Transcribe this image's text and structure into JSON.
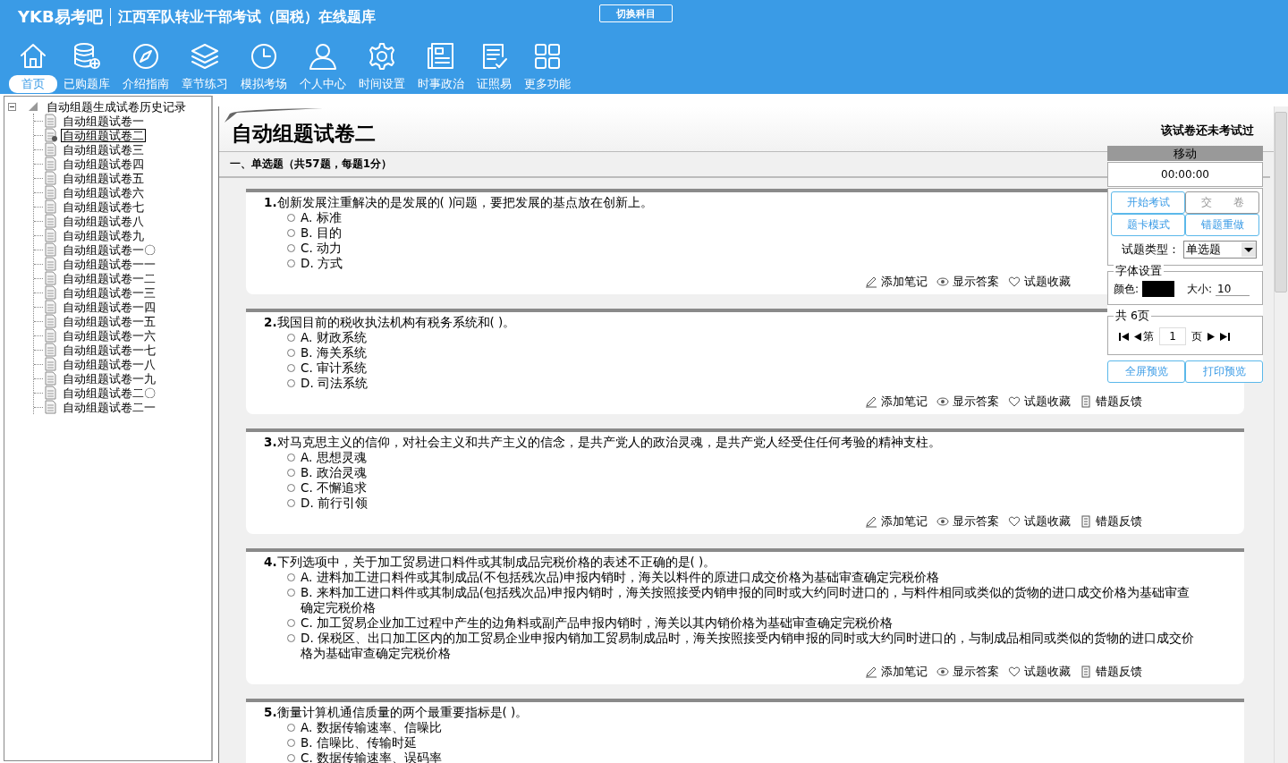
{
  "header": {
    "logo": "YKB易考吧",
    "title": "江西军队转业干部考试（国税）在线题库",
    "switch_button": "切换科目"
  },
  "toolbar": [
    {
      "label": "首页",
      "selected": true
    },
    {
      "label": "已购题库",
      "selected": false
    },
    {
      "label": "介绍指南",
      "selected": false
    },
    {
      "label": "章节练习",
      "selected": false
    },
    {
      "label": "模拟考场",
      "selected": false
    },
    {
      "label": "个人中心",
      "selected": false
    },
    {
      "label": "时间设置",
      "selected": false
    },
    {
      "label": "时事政治",
      "selected": false
    },
    {
      "label": "证照易",
      "selected": false
    },
    {
      "label": "更多功能",
      "selected": false
    }
  ],
  "tree": {
    "label": "自动组题生成试卷历史记录",
    "expanded": true,
    "children": [
      {
        "label": "自动组题试卷一",
        "selected": false
      },
      {
        "label": "自动组题试卷二",
        "selected": true
      },
      {
        "label": "自动组题试卷三",
        "selected": false
      },
      {
        "label": "自动组题试卷四",
        "selected": false
      },
      {
        "label": "自动组题试卷五",
        "selected": false
      },
      {
        "label": "自动组题试卷六",
        "selected": false
      },
      {
        "label": "自动组题试卷七",
        "selected": false
      },
      {
        "label": "自动组题试卷八",
        "selected": false
      },
      {
        "label": "自动组题试卷九",
        "selected": false
      },
      {
        "label": "自动组题试卷一〇",
        "selected": false
      },
      {
        "label": "自动组题试卷一一",
        "selected": false
      },
      {
        "label": "自动组题试卷一二",
        "selected": false
      },
      {
        "label": "自动组题试卷一三",
        "selected": false
      },
      {
        "label": "自动组题试卷一四",
        "selected": false
      },
      {
        "label": "自动组题试卷一五",
        "selected": false
      },
      {
        "label": "自动组题试卷一六",
        "selected": false
      },
      {
        "label": "自动组题试卷一七",
        "selected": false
      },
      {
        "label": "自动组题试卷一八",
        "selected": false
      },
      {
        "label": "自动组题试卷一九",
        "selected": false
      },
      {
        "label": "自动组题试卷二〇",
        "selected": false
      },
      {
        "label": "自动组题试卷二一",
        "selected": false
      }
    ]
  },
  "paper": {
    "title": "自动组题试卷二",
    "status": "该试卷还未考试过",
    "section": "一、单选题（共57题，每题1分）",
    "questions": [
      {
        "number": "1.",
        "text": "创新发展注重解决的是发展的( )问题，要把发展的基点放在创新上。",
        "options": [
          {
            "label": "A. 标准",
            "selected": false
          },
          {
            "label": "B. 目的",
            "selected": false
          },
          {
            "label": "C. 动力",
            "selected": false
          },
          {
            "label": "D. 方式",
            "selected": false
          }
        ],
        "actions": [
          "添加笔记",
          "显示答案",
          "试题收藏"
        ]
      },
      {
        "number": "2.",
        "text": "我国目前的税收执法机构有税务系统和( )。",
        "options": [
          {
            "label": "A. 财政系统",
            "selected": false
          },
          {
            "label": "B. 海关系统",
            "selected": false
          },
          {
            "label": "C. 审计系统",
            "selected": false
          },
          {
            "label": "D. 司法系统",
            "selected": false
          }
        ],
        "actions": [
          "添加笔记",
          "显示答案",
          "试题收藏",
          "错题反馈"
        ]
      },
      {
        "number": "3.",
        "text": "对马克思主义的信仰，对社会主义和共产主义的信念，是共产党人的政治灵魂，是共产党人经受住任何考验的精神支柱。",
        "options": [
          {
            "label": "A. 思想灵魂",
            "selected": false
          },
          {
            "label": "B. 政治灵魂",
            "selected": false
          },
          {
            "label": "C. 不懈追求",
            "selected": false
          },
          {
            "label": "D. 前行引领",
            "selected": false
          }
        ],
        "actions": [
          "添加笔记",
          "显示答案",
          "试题收藏",
          "错题反馈"
        ]
      },
      {
        "number": "4.",
        "text": "下列选项中，关于加工贸易进口料件或其制成品完税价格的表述不正确的是( )。",
        "options": [
          {
            "label": "A. 进料加工进口料件或其制成品(不包括残次品)申报内销时，海关以料件的原进口成交价格为基础审查确定完税价格",
            "selected": false
          },
          {
            "label": "B. 来料加工进口料件或其制成品(包括残次品)申报内销时，海关按照接受内销申报的同时或大约同时进口的，与料件相同或类似的货物的进口成交价格为基础审查确定完税价格",
            "selected": false
          },
          {
            "label": "C. 加工贸易企业加工过程中产生的边角料或副产品申报内销时，海关以其内销价格为基础审查确定完税价格",
            "selected": false
          },
          {
            "label": "D. 保税区、出口加工区内的加工贸易企业申报内销加工贸易制成品时，海关按照接受内销申报的同时或大约同时进口的，与制成品相同或类似的货物的进口成交价格为基础审查确定完税价格",
            "selected": false
          }
        ],
        "actions": [
          "添加笔记",
          "显示答案",
          "试题收藏",
          "错题反馈"
        ]
      },
      {
        "number": "5.",
        "text": "衡量计算机通信质量的两个最重要指标是( )。",
        "options": [
          {
            "label": "A. 数据传输速率、信噪比",
            "selected": false
          },
          {
            "label": "B. 信噪比、传输时延",
            "selected": false
          },
          {
            "label": "C. 数据传输速率、误码率",
            "selected": false
          }
        ]
      }
    ]
  },
  "panel": {
    "header": "移动",
    "timer": "00:00:00",
    "buttons": [
      {
        "label": "开始考试",
        "disabled": false
      },
      {
        "label": "交　　卷",
        "disabled": true
      },
      {
        "label": "题卡模式",
        "disabled": false
      },
      {
        "label": "错题重做",
        "disabled": false
      }
    ],
    "type_label": "试题类型：",
    "type_value": "单选题",
    "font_group": "字体设置",
    "color_label": "颜色:",
    "color": "#000000",
    "size_label": "大小:",
    "size_value": "10",
    "pages_group": "共 6页",
    "page_prefix": "第",
    "page_value": "1",
    "page_suffix": "页",
    "bottom_buttons": [
      {
        "label": "全屏预览",
        "disabled": false
      },
      {
        "label": "打印预览",
        "disabled": false
      }
    ]
  }
}
